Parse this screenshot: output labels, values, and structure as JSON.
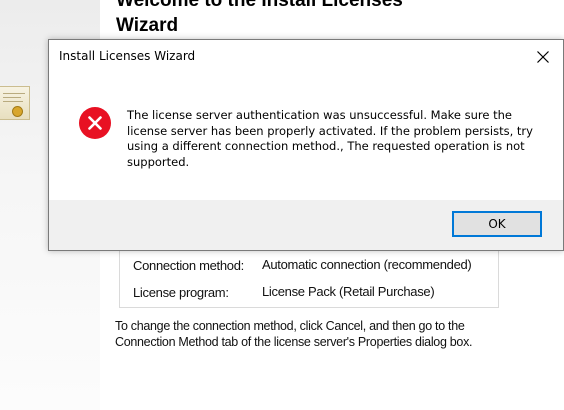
{
  "wizard": {
    "title": "Welcome to the Install Licenses Wizard",
    "connection_method_label": "Connection method:",
    "connection_method_value": "Automatic connection (recommended)",
    "license_program_label": "License program:",
    "license_program_value": "License Pack (Retail Purchase)",
    "note": "To change the connection method, click Cancel, and then go to the Connection Method tab of the license server's Properties dialog box."
  },
  "dialog": {
    "title": "Install Licenses Wizard",
    "message": "The license server authentication was unsuccessful. Make sure the license server has been properly activated. If the problem persists, try using a different connection method., The requested operation is not supported.",
    "ok_label": "OK",
    "icon": "error-icon",
    "close_icon": "close-icon",
    "colors": {
      "error_red": "#e81123",
      "focus_blue": "#0078d7",
      "footer_gray": "#f0f0f0"
    }
  }
}
